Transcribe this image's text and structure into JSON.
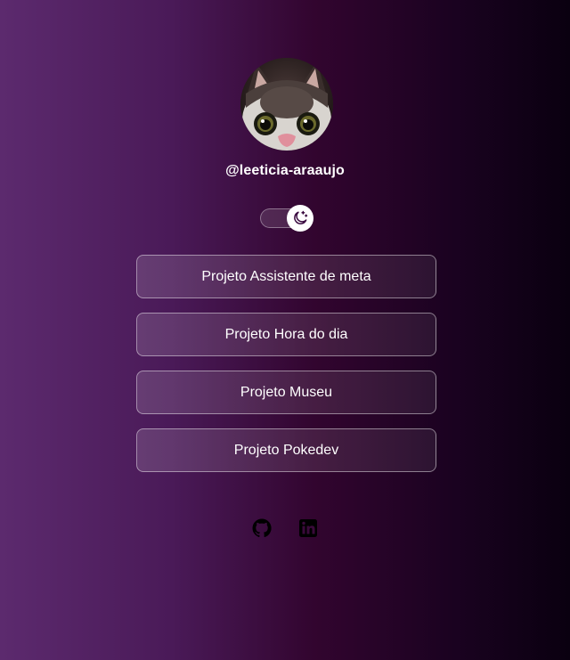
{
  "profile": {
    "username": "@leeticia-araaujo",
    "avatar_icon": "cat-photo-avatar"
  },
  "theme_toggle": {
    "icon": "moon-stars-icon",
    "state": "dark"
  },
  "links": [
    {
      "label": "Projeto Assistente de meta"
    },
    {
      "label": "Projeto Hora do dia"
    },
    {
      "label": "Projeto Museu"
    },
    {
      "label": "Projeto Pokedev"
    }
  ],
  "social": [
    {
      "icon": "github-icon"
    },
    {
      "icon": "linkedin-icon"
    }
  ],
  "colors": {
    "background_left": "#5c2a6e",
    "background_mid": "#32052f",
    "background_right": "#0a0010",
    "text": "#ffffff"
  }
}
